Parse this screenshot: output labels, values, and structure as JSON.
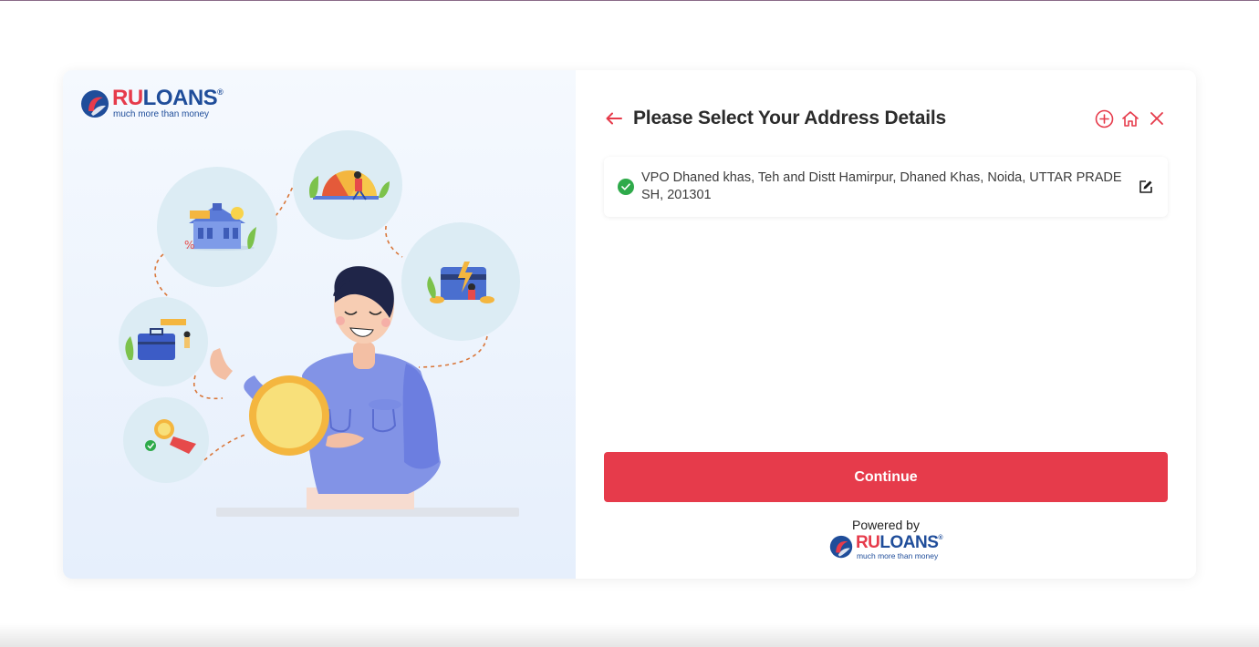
{
  "brand": {
    "name_part1": "RU",
    "name_part2": "LOANS",
    "registered": "®",
    "tagline": "much more than money",
    "logo_icon": "ruloans-logo-icon"
  },
  "colors": {
    "accent": "#e63b4b",
    "brand_blue": "#1f4d9a",
    "success": "#2eaa4a"
  },
  "header": {
    "title": "Please Select Your Address Details",
    "back_icon": "arrow-left-icon",
    "actions": [
      "add-circle-icon",
      "home-icon",
      "close-icon"
    ]
  },
  "addresses": [
    {
      "text": "VPO Dhaned khas, Teh and Distt Hamirpur, Dhaned Khas, Noida, UTTAR PRADESH, 201301",
      "selected": true,
      "status_icon": "check-circle-icon",
      "edit_icon": "edit-icon"
    }
  ],
  "actions": {
    "continue_label": "Continue"
  },
  "footer": {
    "powered_by_label": "Powered by"
  }
}
